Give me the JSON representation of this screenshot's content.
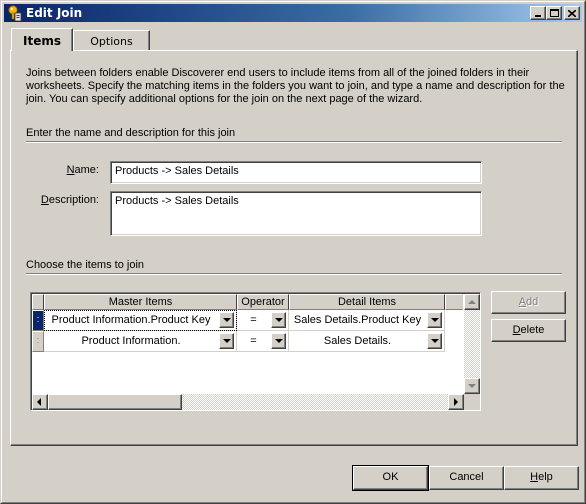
{
  "window": {
    "title": "Edit Join",
    "icon": "keys-icon",
    "controls": {
      "minimize": "minimize-icon",
      "maximize": "maximize-icon",
      "close": "close-icon"
    }
  },
  "tabs": [
    {
      "label": "Items",
      "active": true
    },
    {
      "label": "Options",
      "active": false
    }
  ],
  "intro_text": "Joins between folders enable Discoverer end users to include items from all of the joined folders in their worksheets. Specify the matching items in the folders you want to join, and type a name and description for the join. You can specify additional options for the join on the next page of the wizard.",
  "section_name": "Enter the name and description for this join",
  "fields": {
    "name": {
      "label_mnemonic": "N",
      "label_rest": "ame:",
      "value": "Products -> Sales Details"
    },
    "description": {
      "label_mnemonic": "D",
      "label_rest": "escription:",
      "value": "Products -> Sales Details"
    }
  },
  "section_items": "Choose the items to join",
  "grid": {
    "columns": [
      "Master Items",
      "Operator",
      "Detail Items"
    ],
    "rows": [
      {
        "master": "Product Information.Product Key",
        "operator": "=",
        "detail": "Sales Details.Product Key",
        "selected": true
      },
      {
        "master": "Product Information.",
        "operator": "=",
        "detail": "Sales Details.",
        "selected": false
      }
    ]
  },
  "buttons": {
    "add": {
      "mnemonic": "A",
      "rest": "dd",
      "enabled": false
    },
    "delete": {
      "mnemonic": "D",
      "rest": "elete",
      "enabled": true
    },
    "ok": "OK",
    "cancel": "Cancel",
    "help": {
      "mnemonic": "H",
      "rest": "elp"
    }
  },
  "colors": {
    "title_gradient_start": "#0a246a",
    "title_gradient_end": "#a6caf0",
    "face": "#d4d0c8"
  }
}
